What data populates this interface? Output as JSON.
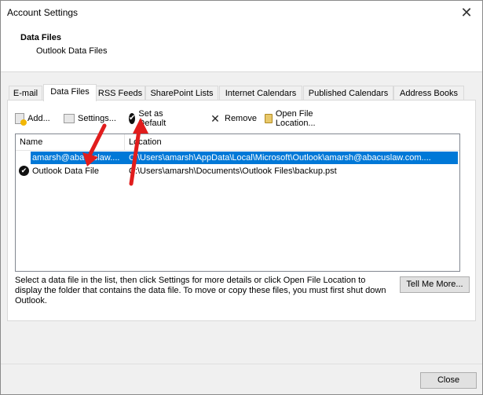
{
  "window": {
    "title": "Account Settings"
  },
  "header": {
    "title": "Data Files",
    "subtitle": "Outlook Data Files"
  },
  "tabs": [
    {
      "label": "E-mail"
    },
    {
      "label": "Data Files"
    },
    {
      "label": "RSS Feeds"
    },
    {
      "label": "SharePoint Lists"
    },
    {
      "label": "Internet Calendars"
    },
    {
      "label": "Published Calendars"
    },
    {
      "label": "Address Books"
    }
  ],
  "toolbar": {
    "add": "Add...",
    "settings": "Settings...",
    "set_default": "Set as Default",
    "remove": "Remove",
    "open_location": "Open File Location..."
  },
  "table": {
    "columns": [
      "Name",
      "Location"
    ],
    "rows": [
      {
        "name": "amarsh@abacuslaw....",
        "location": "C:\\Users\\amarsh\\AppData\\Local\\Microsoft\\Outlook\\amarsh@abacuslaw.com....",
        "selected": true,
        "default": false
      },
      {
        "name": "Outlook Data File",
        "location": "C:\\Users\\amarsh\\Documents\\Outlook Files\\backup.pst",
        "selected": false,
        "default": true
      }
    ]
  },
  "help_text": "Select a data file in the list, then click Settings for more details or click Open File Location to display the folder that contains the data file. To move or copy these files, you must first shut down Outlook.",
  "buttons": {
    "tell_me_more": "Tell Me More...",
    "close": "Close"
  },
  "colors": {
    "selection": "#0078d7",
    "arrow": "#e11d1d"
  },
  "icons": {
    "check": "✔",
    "close": "✕",
    "remove": "✕"
  }
}
